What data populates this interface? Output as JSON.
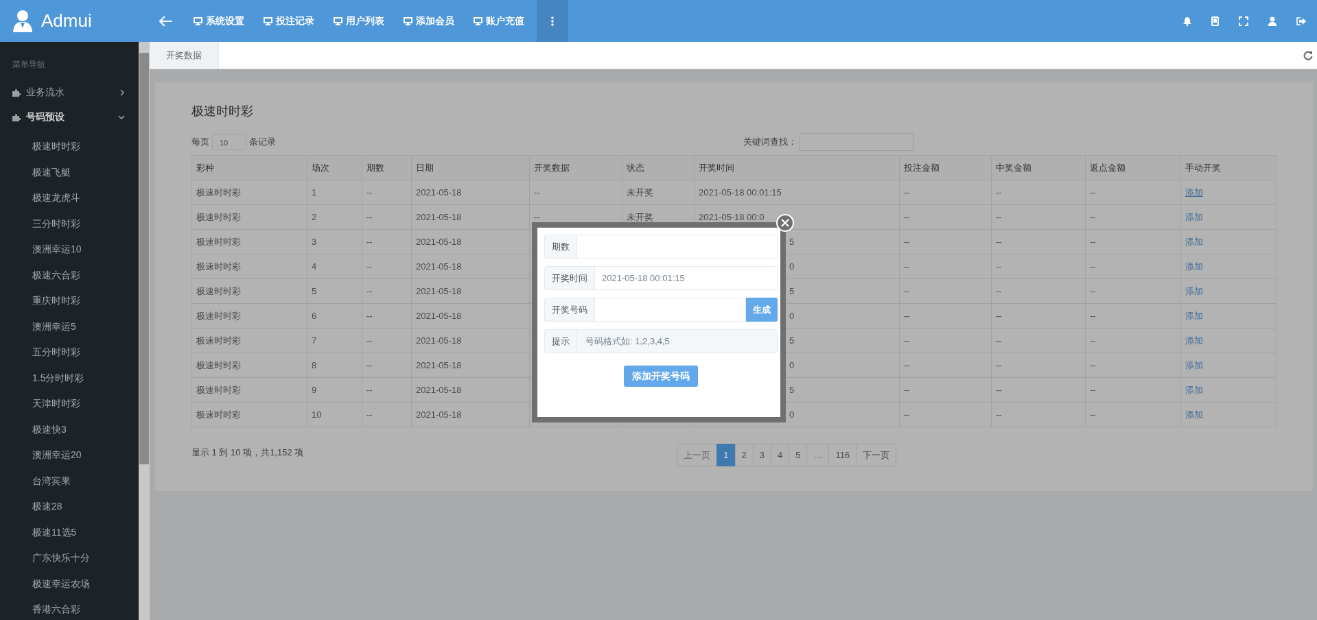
{
  "header": {
    "logo": "Admui",
    "nav": [
      {
        "label": "系统设置"
      },
      {
        "label": "投注记录"
      },
      {
        "label": "用户列表"
      },
      {
        "label": "添加会员"
      },
      {
        "label": "账户充值"
      }
    ],
    "more_menu": {
      "selected": true
    }
  },
  "tabs": [
    {
      "label": "开奖数据",
      "selected": true
    }
  ],
  "sidebar": {
    "heading": "菜单导航",
    "groups": [
      {
        "label": "业务流水",
        "expanded": false
      },
      {
        "label": "号码预设",
        "expanded": true,
        "children": [
          {
            "label": "极速时时彩"
          },
          {
            "label": "极速飞艇"
          },
          {
            "label": "极速龙虎斗"
          },
          {
            "label": "三分时时彩"
          },
          {
            "label": "澳洲幸运10"
          },
          {
            "label": "极速六合彩"
          },
          {
            "label": "重庆时时彩"
          },
          {
            "label": "澳洲幸运5"
          },
          {
            "label": "五分时时彩"
          },
          {
            "label": "1.5分时时彩"
          },
          {
            "label": "天津时时彩"
          },
          {
            "label": "极速快3"
          },
          {
            "label": "澳洲幸运20"
          },
          {
            "label": "台湾宾果"
          },
          {
            "label": "极速28"
          },
          {
            "label": "极速11选5"
          },
          {
            "label": "广东快乐十分"
          },
          {
            "label": "极速幸运农场"
          },
          {
            "label": "香港六合彩"
          }
        ]
      }
    ]
  },
  "panel": {
    "title": "极速时时彩",
    "page_size_prefix": "每页",
    "page_size": "10",
    "page_size_suffix": "条记录",
    "search_label": "关键词查找：",
    "columns": [
      "彩种",
      "场次",
      "期数",
      "日期",
      "开奖数据",
      "状态",
      "开奖时间",
      "投注金额",
      "中奖金额",
      "返点金额",
      "手动开奖"
    ],
    "rows": [
      {
        "lottery": "极速时时彩",
        "round": "1",
        "period": "--",
        "date": "2021-05-18",
        "result": "--",
        "status": "未开奖",
        "draw_time": "2021-05-18 00:01:15",
        "draw_time_cut": false,
        "bet": "--",
        "win": "--",
        "rebate": "--",
        "action": "添加"
      },
      {
        "lottery": "极速时时彩",
        "round": "2",
        "period": "--",
        "date": "2021-05-18",
        "result": "--",
        "status": "未开奖",
        "draw_time": "2021-05-18 00:0",
        "draw_time_cut": false,
        "bet": "--",
        "win": "--",
        "rebate": "--",
        "action": "添加"
      },
      {
        "lottery": "极速时时彩",
        "round": "3",
        "period": "--",
        "date": "2021-05-18",
        "draw_time": "5",
        "draw_time_cut": true,
        "bet": "--",
        "win": "--",
        "rebate": "--",
        "action": "添加"
      },
      {
        "lottery": "极速时时彩",
        "round": "4",
        "period": "--",
        "date": "2021-05-18",
        "draw_time": "0",
        "draw_time_cut": true,
        "bet": "--",
        "win": "--",
        "rebate": "--",
        "action": "添加"
      },
      {
        "lottery": "极速时时彩",
        "round": "5",
        "period": "--",
        "date": "2021-05-18",
        "draw_time": "5",
        "draw_time_cut": true,
        "bet": "--",
        "win": "--",
        "rebate": "--",
        "action": "添加"
      },
      {
        "lottery": "极速时时彩",
        "round": "6",
        "period": "--",
        "date": "2021-05-18",
        "draw_time": "0",
        "draw_time_cut": true,
        "bet": "--",
        "win": "--",
        "rebate": "--",
        "action": "添加"
      },
      {
        "lottery": "极速时时彩",
        "round": "7",
        "period": "--",
        "date": "2021-05-18",
        "draw_time": "5",
        "draw_time_cut": true,
        "bet": "--",
        "win": "--",
        "rebate": "--",
        "action": "添加"
      },
      {
        "lottery": "极速时时彩",
        "round": "8",
        "period": "--",
        "date": "2021-05-18",
        "draw_time": "0",
        "draw_time_cut": true,
        "bet": "--",
        "win": "--",
        "rebate": "--",
        "action": "添加"
      },
      {
        "lottery": "极速时时彩",
        "round": "9",
        "period": "--",
        "date": "2021-05-18",
        "draw_time": "5",
        "draw_time_cut": true,
        "bet": "--",
        "win": "--",
        "rebate": "--",
        "action": "添加"
      },
      {
        "lottery": "极速时时彩",
        "round": "10",
        "period": "--",
        "date": "2021-05-18",
        "draw_time": "0",
        "draw_time_cut": true,
        "bet": "--",
        "win": "--",
        "rebate": "--",
        "action": "添加"
      }
    ],
    "summary": "显示 1 到 10 项，共1,152 项",
    "pagination": [
      {
        "label": "上一页",
        "selected": false,
        "disabled": true
      },
      {
        "label": "1",
        "selected": true,
        "disabled": false
      },
      {
        "label": "2",
        "selected": false,
        "disabled": false
      },
      {
        "label": "3",
        "selected": false,
        "disabled": false
      },
      {
        "label": "4",
        "selected": false,
        "disabled": false
      },
      {
        "label": "5",
        "selected": false,
        "disabled": false
      },
      {
        "label": "…",
        "selected": false,
        "disabled": true
      },
      {
        "label": "116",
        "selected": false,
        "disabled": false
      },
      {
        "label": "下一页",
        "selected": false,
        "disabled": false
      }
    ]
  },
  "modal": {
    "fields": [
      {
        "kind": "input",
        "label": "期数"
      },
      {
        "kind": "input",
        "label": "开奖时间",
        "value": "2021-05-18 00:01:15"
      },
      {
        "kind": "input-button",
        "label": "开奖号码",
        "button": "生成"
      },
      {
        "kind": "readonly",
        "label": "提示",
        "value": "号码格式如: 1,2,3,4,5"
      }
    ],
    "submit": "添加开奖号码"
  }
}
